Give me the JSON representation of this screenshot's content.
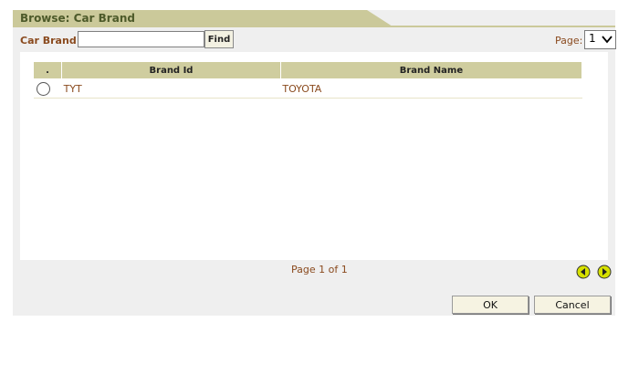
{
  "window": {
    "title": "Browse: Car Brand"
  },
  "search": {
    "label": "Car Brand :",
    "value": "",
    "placeholder": "",
    "find_label": "Find"
  },
  "paging": {
    "label": "Page:",
    "selected": "1",
    "summary": "Page 1 of 1"
  },
  "table": {
    "columns": [
      ".",
      "Brand Id",
      "Brand Name"
    ],
    "rows": [
      {
        "selected": false,
        "brand_id": "TYT",
        "brand_name": "TOYOTA"
      }
    ]
  },
  "nav": {
    "prev_icon": "prev-arrow-icon",
    "next_icon": "next-arrow-icon"
  },
  "buttons": {
    "ok": "OK",
    "cancel": "Cancel"
  },
  "colors": {
    "tab": "#cbc99a",
    "header": "#cfcd9f",
    "title": "#4d5a2a",
    "label": "#8a4a1e",
    "nav_icon": "#d6e000"
  }
}
